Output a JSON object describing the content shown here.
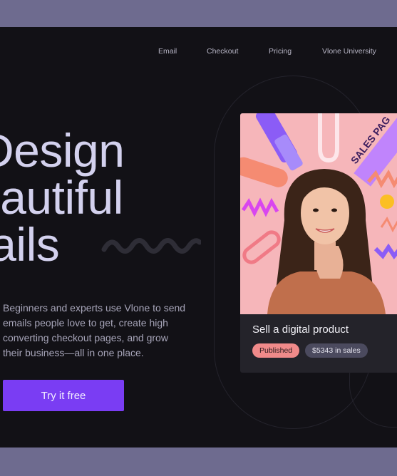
{
  "nav": {
    "items": [
      "Email",
      "Checkout",
      "Pricing",
      "Vlone University"
    ]
  },
  "hero": {
    "headline": [
      "Design",
      "eautiful",
      "nails"
    ],
    "description": "Beginners and experts use Vlone to send emails people love to get, create high converting checkout pages, and grow their business—all in one place.",
    "cta_label": "Try it free"
  },
  "card": {
    "image_text": "SALES PAG",
    "title": "Sell a digital product",
    "status_badge": "Published",
    "sales_badge": "$5343 in sales"
  },
  "colors": {
    "background": "#121116",
    "accent": "#7a3df3",
    "headline": "#d3d1ee",
    "card_image_bg": "#f6b6ba",
    "published_badge": "#f08a8a"
  }
}
